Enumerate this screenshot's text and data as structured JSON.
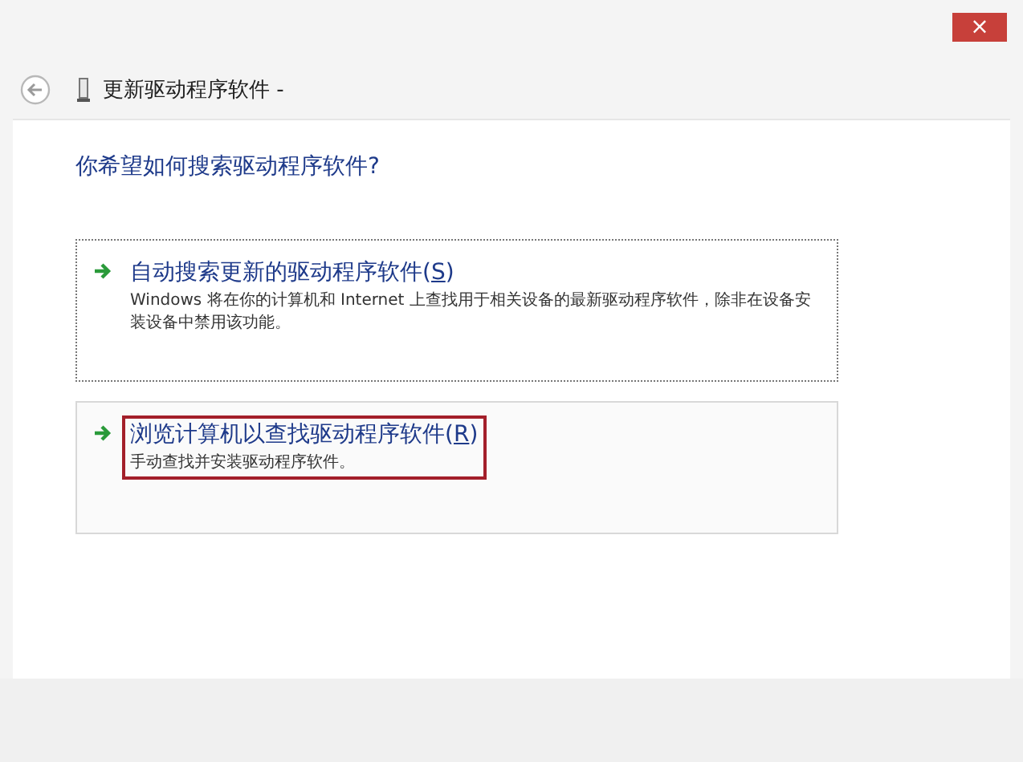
{
  "window": {
    "close": "×",
    "title": "更新驱动程序软件 -"
  },
  "heading": "你希望如何搜索驱动程序软件?",
  "options": [
    {
      "title": "自动搜索更新的驱动程序软件(",
      "access_key": "S",
      "title_end": ")",
      "description": "Windows 将在你的计算机和 Internet 上查找用于相关设备的最新驱动程序软件，除非在设备安装设备中禁用该功能。",
      "focused": true,
      "highlighted": false
    },
    {
      "title": "浏览计算机以查找驱动程序软件(",
      "access_key": "R",
      "title_end": ")",
      "description": "手动查找并安装驱动程序软件。",
      "focused": false,
      "highlighted": true
    }
  ]
}
